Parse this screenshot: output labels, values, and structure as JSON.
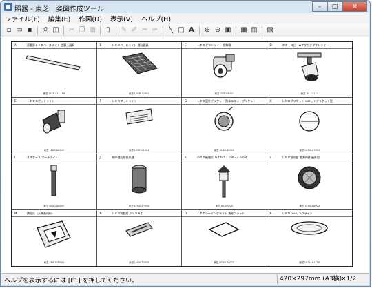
{
  "window": {
    "title": "照器 - 東芝　姿図作成ツール"
  },
  "menu": [
    "ファイル(F)",
    "編集(E)",
    "作図(D)",
    "表示(V)",
    "ヘルプ(H)"
  ],
  "toolbar": {
    "icons": [
      "new-icon",
      "open-icon",
      "save-icon",
      "print-icon",
      "preview-icon",
      "cut-icon",
      "copy-icon",
      "paste-icon",
      "page-icon",
      "edit-icon",
      "edit2-icon",
      "cut2-icon",
      "paste2-icon",
      "line-icon",
      "rect-icon",
      "text-icon",
      "zoom-in-icon",
      "zoom-out-icon",
      "frame-icon",
      "properties-icon",
      "clipboard-icon",
      "image-icon"
    ]
  },
  "cells": [
    {
      "num": "A",
      "label": "直管形ＬＥＤベースライト 逆富士器具",
      "model": "東芝 LEKT-423 LE9"
    },
    {
      "num": "B",
      "label": "ＬＥＤベースライト 埋込器具",
      "model": "東芝 LEDR-32001"
    },
    {
      "num": "C",
      "label": "ＬＥＤダウンライト 傾斜用",
      "model": "東芝 LEDD-8001"
    },
    {
      "num": "D",
      "label": "ネオーロビームフタ付きダウンライト",
      "model": "東芝 DS-11173"
    },
    {
      "num": "E",
      "label": "ＬＥＤスポットライト",
      "model": "東芝 LEDS-88000"
    },
    {
      "num": "F",
      "label": "ＬＥＤフットライト",
      "model": "東芝 LEDF-91004"
    },
    {
      "num": "G",
      "label": "ＬＥＤ屋外ブラケット 防水ユニットブラケット",
      "model": "東芝 LEDB-88909"
    },
    {
      "num": "H",
      "label": "ＬＥＤブラケット ユニットブラケット型",
      "model": "東芝 LEDB-87903"
    },
    {
      "num": "I",
      "label": "ネオポール ポーチライト",
      "model": "東芝 LEDG-88902"
    },
    {
      "num": "J",
      "label": "地中埋込形投光器",
      "model": "東芝 LEDG-87904"
    },
    {
      "num": "K",
      "label": "ＨＩＤ街路灯 ＨＩＤ１１０Ｗ－４００Ｗ",
      "model": "東芝 RS-42004"
    },
    {
      "num": "L",
      "label": "ＬＥＤ投光器 電源内蔵 屋外用",
      "model": "東芝 LEDS-88003"
    },
    {
      "num": "M",
      "label": "誘導灯（天井直付形）",
      "model": "東芝 FBK-10502N"
    },
    {
      "num": "N",
      "label": "ＬＥＤ防犯灯 ２０ＶＡ用",
      "model": "東芝 LEDK-70935"
    },
    {
      "num": "O",
      "label": "ＬＥＤシーリングライト 角形フラット",
      "model": "東芝 LEDH-80272"
    },
    {
      "num": "P",
      "label": "ＬＥＤシーリングライト",
      "model": "東芝 LEDH-81718"
    }
  ],
  "status": {
    "message": "ヘルプを表示するには [F1] を押してください。",
    "paper": "420×297mm (A3横)",
    "page": "×1/2"
  }
}
